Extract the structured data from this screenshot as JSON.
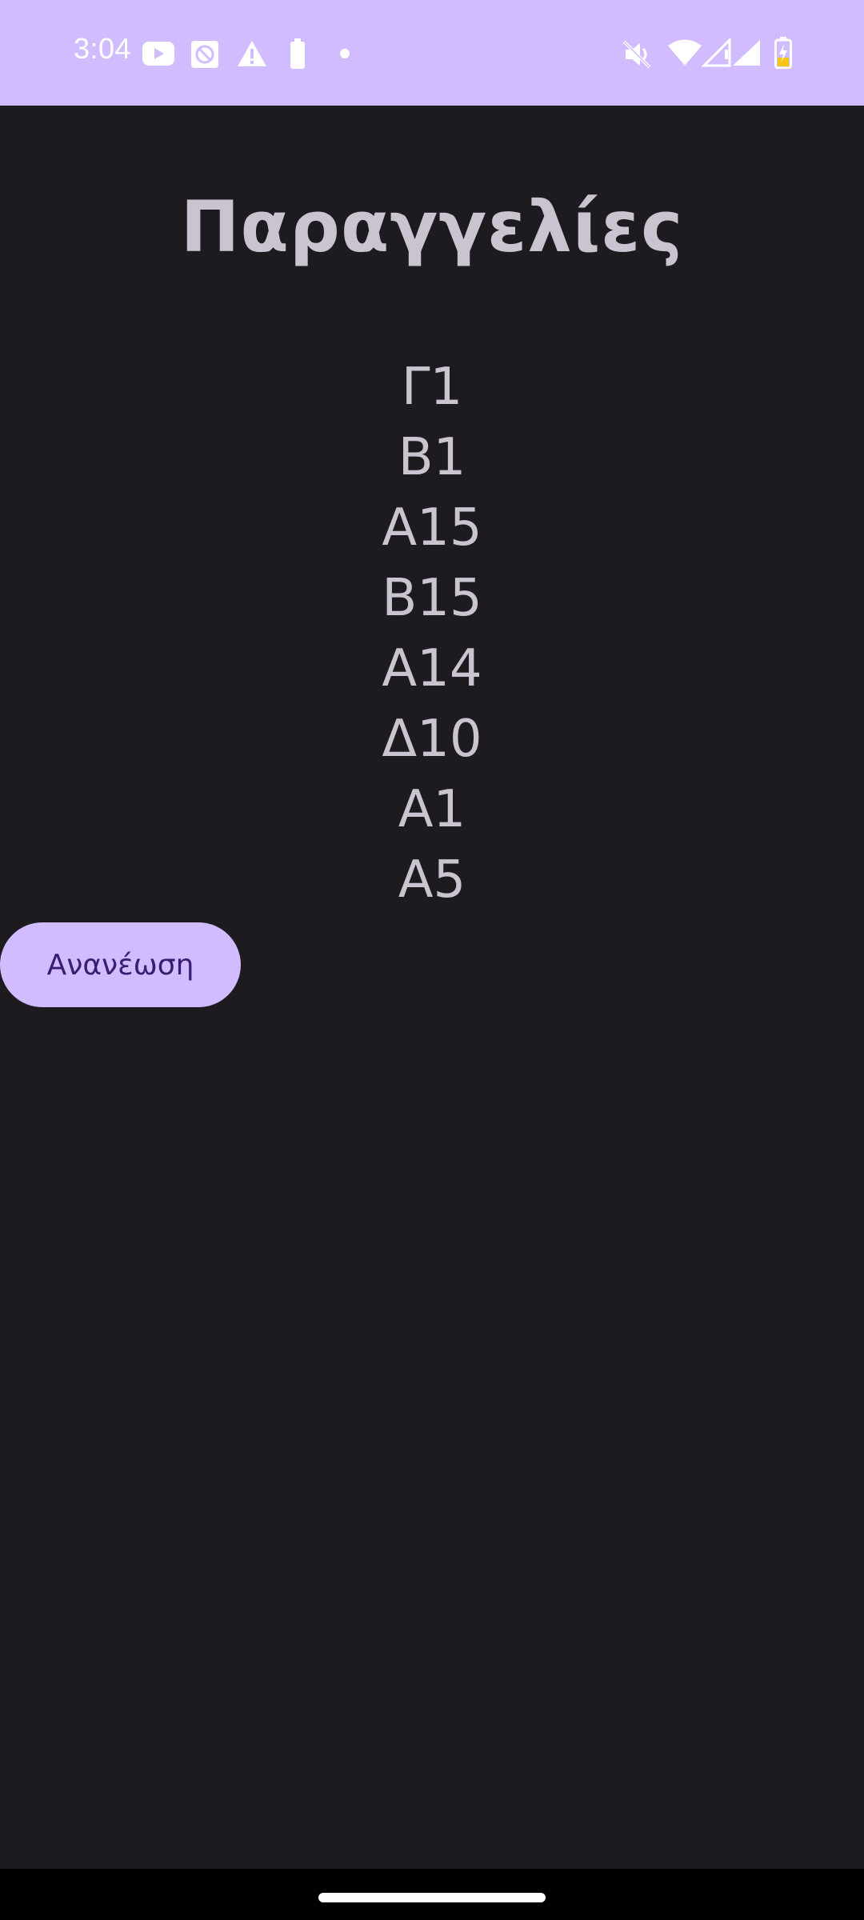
{
  "status_bar": {
    "time": "3:04",
    "background": "#d0bcff",
    "left_icons": [
      "youtube-icon",
      "app-notification-icon",
      "warning-icon",
      "battery-saver-icon",
      "dot-icon"
    ],
    "right_icons": [
      "mute-icon",
      "wifi-icon",
      "signal-empty-icon",
      "signal-icon",
      "battery-charging-icon"
    ]
  },
  "page": {
    "title": "Παραγγελίες"
  },
  "orders": [
    "Γ1",
    "Β1",
    "Α15",
    "Β15",
    "Α14",
    "Δ10",
    "Α1",
    "Α5"
  ],
  "refresh_button": {
    "label": "Ανανέωση"
  },
  "colors": {
    "background": "#1d1b20",
    "accent": "#d0bcff",
    "text": "#cac4d0",
    "button_text": "#381e72"
  }
}
